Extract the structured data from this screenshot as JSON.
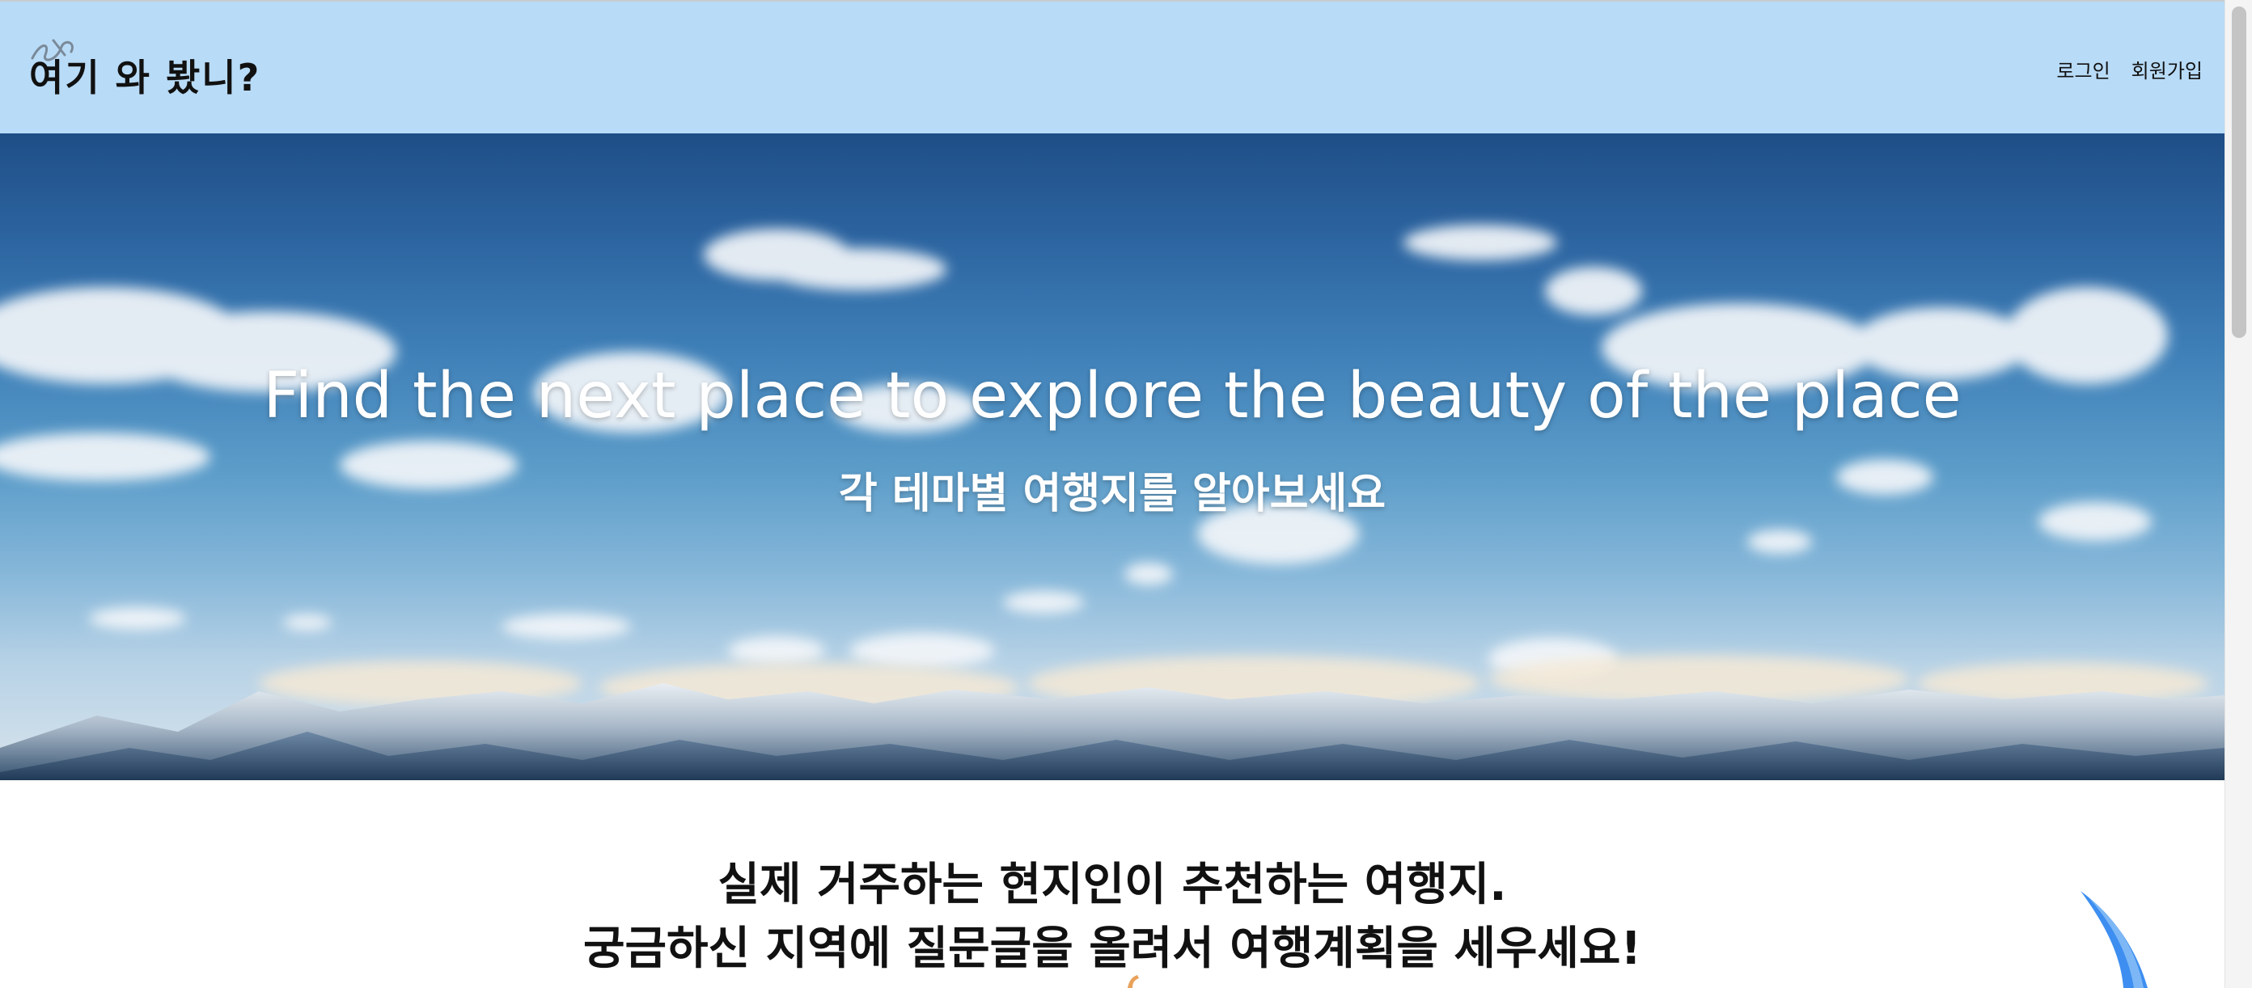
{
  "header": {
    "logo_text": "여기 와 봤니?",
    "logo_mark_icon": "scribble-icon",
    "nav": {
      "login": "로그인",
      "signup": "회원가입"
    }
  },
  "hero": {
    "title": "Find the next place to explore the beauty of the place",
    "subtitle": "각 테마별 여행지를 알아보세요"
  },
  "intro": {
    "line1": "실제 거주하는 현지인이 추천하는 여행지.",
    "line2": "궁금하신 지역에 질문글을 올려서 여행계획을 세우세요!"
  },
  "colors": {
    "header_bg": "#b8dbf7",
    "sky_top": "#1f4e86",
    "text_dark": "#111111",
    "hero_text": "#ffffff",
    "deco_blue": "#3d8ef0"
  }
}
